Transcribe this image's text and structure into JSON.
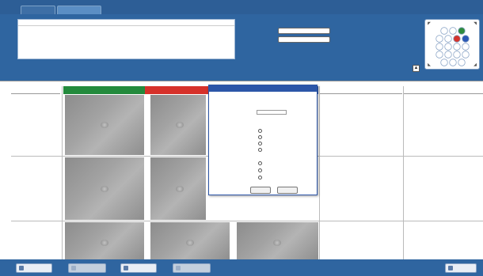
{
  "tabs": [
    {
      "label": ""
    },
    {
      "label": ""
    }
  ],
  "info_box": {
    "title": "",
    "fields": [
      {
        "key": "",
        "value": ""
      },
      {
        "key": "",
        "value": ""
      },
      {
        "key": "",
        "value": ""
      },
      {
        "key": "",
        "value": ""
      },
      {
        "key": "",
        "value": ""
      },
      {
        "key": "",
        "value": ""
      },
      {
        "key": "",
        "value": ""
      }
    ]
  },
  "times": [
    {
      "label": "",
      "value": ""
    },
    {
      "label": "",
      "value": ""
    }
  ],
  "plate": {
    "colors": {
      "green": "#2e8b3e",
      "red": "#d4322b",
      "blue": "#2a57b5",
      "empty": "#ffffff",
      "border": "#8fa8c8"
    }
  },
  "grid": {
    "corner_label": "",
    "columns": [
      {
        "label": "",
        "color": "green"
      },
      {
        "label": "",
        "color": "red"
      },
      {
        "label": "",
        "color": "blue"
      },
      {
        "label": "",
        "color": "plain"
      },
      {
        "label": "",
        "color": "plain"
      }
    ],
    "rows": [
      {
        "label": ""
      },
      {
        "label": ""
      },
      {
        "label": ""
      }
    ]
  },
  "dialog": {
    "title": "",
    "fields": [
      {
        "label": "",
        "value": ""
      },
      {
        "label": "",
        "value": ""
      },
      {
        "label": "",
        "value": ""
      },
      {
        "label": "",
        "value": ""
      }
    ],
    "options_label": "",
    "options": [
      "",
      "",
      "",
      ""
    ],
    "radio_label": "",
    "radio_options": [
      "",
      "",
      ""
    ],
    "ok_label": "",
    "cancel_label": ""
  },
  "toolbar": {
    "buttons": [
      {
        "label": ""
      },
      {
        "label": ""
      },
      {
        "label": ""
      },
      {
        "label": ""
      },
      {
        "label": ""
      }
    ]
  }
}
